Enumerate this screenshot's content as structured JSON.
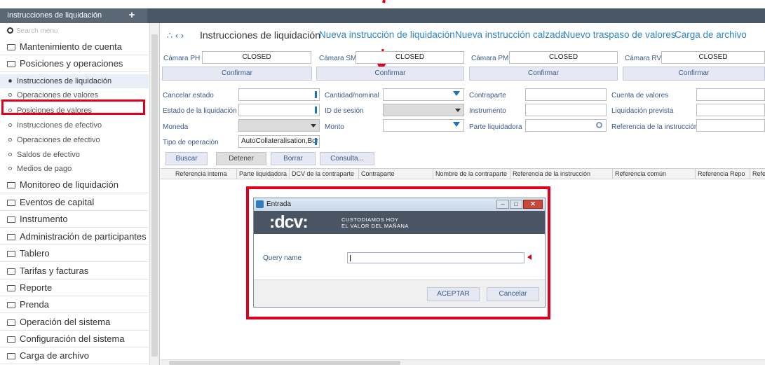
{
  "topbar": {
    "tab_label": "Instrucciones de liquidación",
    "add_label": "+"
  },
  "sidebar": {
    "search_placeholder": "Search menu",
    "items": [
      {
        "label": "Mantenimiento de cuenta"
      },
      {
        "label": "Posiciones y operaciones"
      }
    ],
    "subitems": [
      {
        "label": "Instrucciones de liquidación",
        "active": true
      },
      {
        "label": "Operaciones de valores"
      },
      {
        "label": "Posiciones de valores"
      },
      {
        "label": "Instrucciones de efectivo"
      },
      {
        "label": "Operaciones de efectivo"
      },
      {
        "label": "Saldos de efectivo"
      },
      {
        "label": "Medios de pago"
      }
    ],
    "items_after": [
      {
        "label": "Monitoreo de liquidación"
      },
      {
        "label": "Eventos de capital"
      },
      {
        "label": "Instrumento"
      },
      {
        "label": "Administración de participantes"
      },
      {
        "label": "Tablero"
      },
      {
        "label": "Tarifas y facturas"
      },
      {
        "label": "Reporte"
      },
      {
        "label": "Prenda"
      },
      {
        "label": "Operación del sistema"
      },
      {
        "label": "Configuración del sistema"
      },
      {
        "label": "Carga de archivo"
      }
    ]
  },
  "header": {
    "nav": "∴ ‹ ›",
    "title": "Instrucciones de liquidación",
    "links": [
      "Nueva instrucción de liquidación",
      "Nueva instrucción calzada",
      "Nuevo traspaso de valores",
      "Carga de archivo"
    ]
  },
  "camaras": [
    {
      "label": "Cámara PH",
      "status": "CLOSED",
      "button": "Confirmar"
    },
    {
      "label": "Cámara SM",
      "status": "CLOSED",
      "button": "Confirmar"
    },
    {
      "label": "Cámara PM",
      "status": "CLOSED",
      "button": "Confirmar"
    },
    {
      "label": "Cámara RV",
      "status": "CLOSED",
      "button": "Confirmar"
    }
  ],
  "filters": {
    "cancelar_estado": "Cancelar estado",
    "estado_liquidacion": "Estado de la liquidación",
    "moneda": "Moneda",
    "tipo_operacion": "Tipo de operación",
    "tipo_operacion_value": "AutoCollateralisation,Bor",
    "cantidad_nominal": "Cantidad/nominal",
    "id_sesion": "ID de sesión",
    "monto": "Monto",
    "contraparte": "Contraparte",
    "instrumento": "Instrumento",
    "parte_liquidadora": "Parte liquidadora",
    "cuenta_valores": "Cuenta de valores",
    "liquidacion_prevista": "Liquidación prevista",
    "referencia_instruccion": "Referencia de la instrucción"
  },
  "actions": {
    "buscar": "Buscar",
    "detener": "Detener",
    "borrar": "Borrar",
    "consulta": "Consulta..."
  },
  "grid": {
    "columns": [
      "Referencia interna",
      "Parte liquidadora",
      "DCV de la contraparte",
      "Contraparte",
      "Nombre de la contraparte",
      "Referencia de la instrucción",
      "Referencia común",
      "Referencia Repo",
      "Refe"
    ]
  },
  "modal": {
    "title": "Entrada",
    "logo": ":dcv:",
    "tagline_1": "CUSTODIAMOS HOY",
    "tagline_2": "EL VALOR DEL MAÑANA",
    "query_label": "Query name",
    "query_value": "",
    "accept": "ACEPTAR",
    "cancel": "Cancelar",
    "win_min": "–",
    "win_max": "□",
    "win_close": "✕"
  },
  "colors": {
    "annotation": "#e0001b",
    "topbar": "#4a5866",
    "link": "#2f86c8"
  }
}
